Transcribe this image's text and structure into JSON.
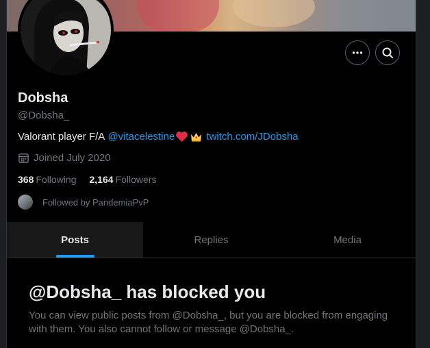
{
  "profile": {
    "name": "Dobsha",
    "handle": "@Dobsha_",
    "bio": {
      "text": "Valorant player F/A",
      "mention": "@vitacelestine",
      "emojis": [
        "heart",
        "crown"
      ],
      "link": "twitch.com/JDobsha"
    },
    "joined": "Joined July 2020",
    "following_count": "368",
    "following_label": "Following",
    "followers_count": "2,164",
    "followers_label": "Followers",
    "followed_by": "Followed by PandemiaPvP"
  },
  "actions": {
    "more_icon": "more-icon",
    "search_icon": "search-icon"
  },
  "tabs": [
    {
      "label": "Posts",
      "active": true
    },
    {
      "label": "Replies",
      "active": false
    },
    {
      "label": "Media",
      "active": false
    }
  ],
  "blocked": {
    "title": "@Dobsha_ has blocked you",
    "body": "You can view public posts from @Dobsha_, but you are blocked from engaging with them. You also cannot follow or message @Dobsha_."
  },
  "colors": {
    "accent": "#1d9bf0",
    "background": "#000000",
    "muted_text": "#71767b",
    "primary_text": "#e7e9ea",
    "border": "#2f3336"
  }
}
